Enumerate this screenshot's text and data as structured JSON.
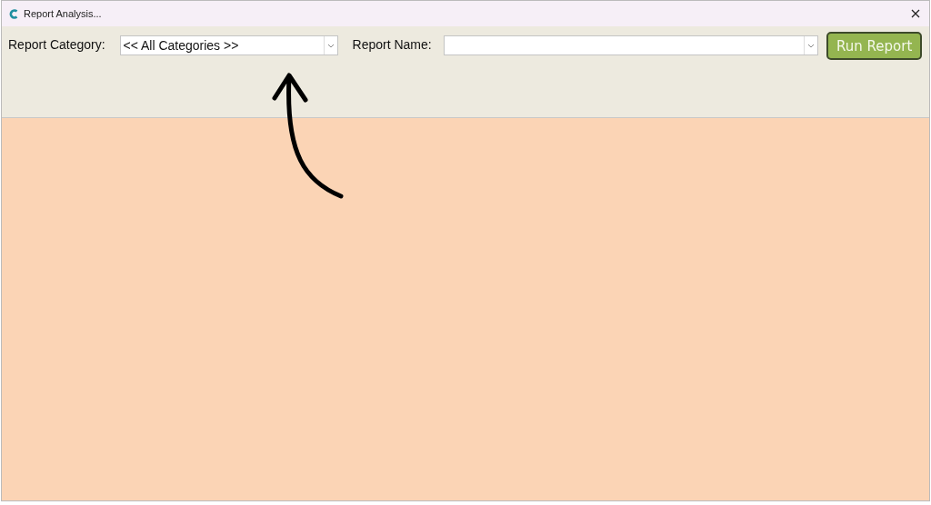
{
  "window": {
    "title": "Report Analysis..."
  },
  "toolbar": {
    "category_label": "Report Category:",
    "category_value": "<< All Categories >>",
    "name_label": "Report Name:",
    "run_button": "Run Report"
  }
}
